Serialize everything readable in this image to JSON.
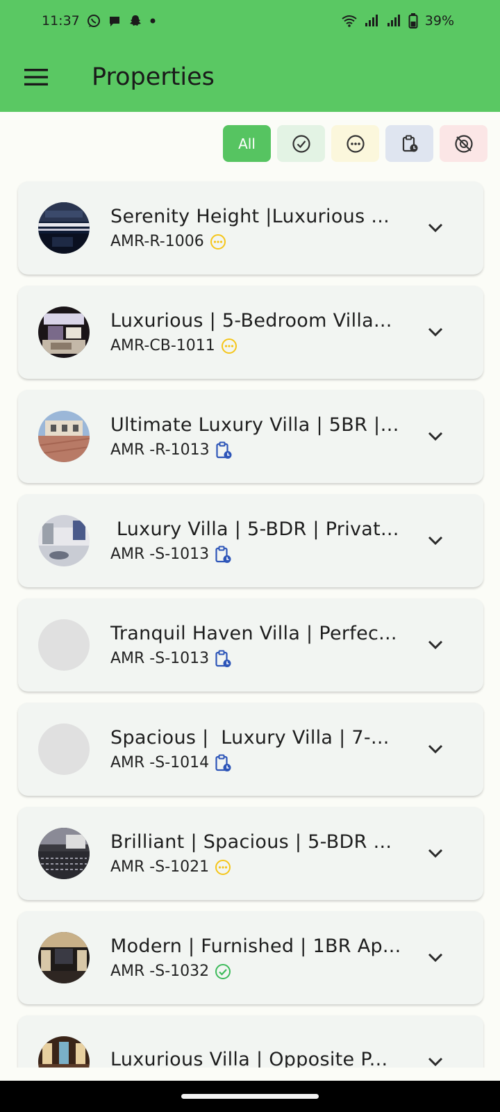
{
  "status": {
    "time": "11:37",
    "battery": "39%",
    "icons": [
      "whatsapp-icon",
      "message-icon",
      "snapchat-icon",
      "dot-icon",
      "wifi-icon",
      "signal-icon",
      "signal-icon",
      "battery-icon"
    ]
  },
  "appbar": {
    "title": "Properties",
    "menu_icon": "menu-icon"
  },
  "filters": [
    {
      "label": "All",
      "icon": null,
      "selected": true
    },
    {
      "label": "",
      "icon": "check-circle-icon"
    },
    {
      "label": "",
      "icon": "more-circle-icon"
    },
    {
      "label": "",
      "icon": "clipboard-clock-icon"
    },
    {
      "label": "",
      "icon": "slash-circle-icon"
    }
  ],
  "colors": {
    "primary": "#5ac863",
    "pending": "#f5c518",
    "scheduled": "#2d55b8",
    "approved": "#3cba5a"
  },
  "properties": [
    {
      "title": "Serenity Height |Luxurious ...",
      "code": "AMR-R-1006",
      "status": "pending"
    },
    {
      "title": "Luxurious | 5-Bedroom Villa...",
      "code": "AMR-CB-1011",
      "status": "pending"
    },
    {
      "title": "Ultimate Luxury Villa | 5BR | ...",
      "code": "AMR -R-1013",
      "status": "scheduled"
    },
    {
      "title": " Luxury Villa | 5-BDR | Privat...",
      "code": "AMR -S-1013",
      "status": "scheduled"
    },
    {
      "title": "Tranquil Haven Villa | Perfec...",
      "code": "AMR -S-1013",
      "status": "scheduled"
    },
    {
      "title": "Spacious |  Luxury Villa | 7-...",
      "code": "AMR -S-1014",
      "status": "scheduled"
    },
    {
      "title": "Brilliant | Spacious | 5-BDR ...",
      "code": "AMR -S-1021",
      "status": "pending"
    },
    {
      "title": "Modern | Furnished | 1BR Ap...",
      "code": "AMR -S-1032",
      "status": "approved"
    },
    {
      "title": "Luxurious Villa | Opposite P...",
      "code": "",
      "status": ""
    }
  ]
}
